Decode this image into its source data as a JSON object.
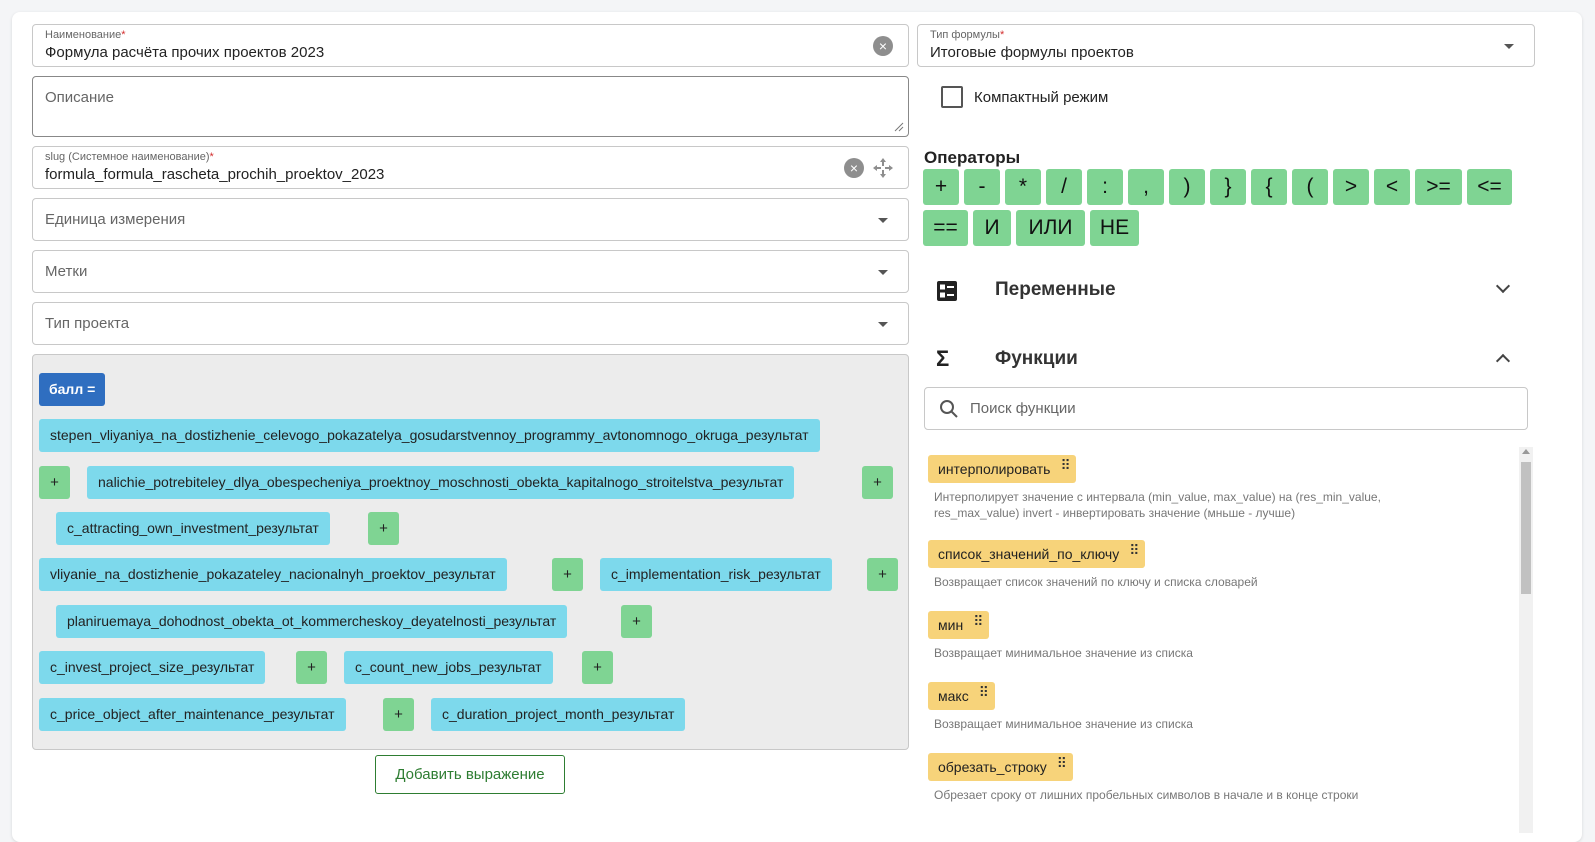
{
  "form": {
    "name_label": "Наименование",
    "name_req": "*",
    "name_value": "Формула расчёта прочих проектов 2023",
    "description_placeholder": "Описание",
    "slug_label": "slug (Системное наименование)",
    "slug_req": "*",
    "slug_value": "formula_formula_rascheta_prochih_proektov_2023",
    "unit_placeholder": "Единица измерения",
    "tags_placeholder": "Метки",
    "project_type_placeholder": "Тип проекта"
  },
  "formula_type": {
    "label": "Тип формулы",
    "req": "*",
    "value": "Итоговые формулы проектов"
  },
  "compact_mode": {
    "label": "Компактный режим",
    "checked": false
  },
  "expression": {
    "score_label": "балл =",
    "chips": [
      "stepen_vliyaniya_na_dostizhenie_celevogo_pokazatelya_gosudarstvennoy_programmy_avtonomnogo_okruga_результат",
      "nalichie_potrebiteley_dlya_obespecheniya_proektnoy_moschnosti_obekta_kapitalnogo_stroitelstva_результат",
      "c_attracting_own_investment_результат",
      "vliyanie_na_dostizhenie_pokazateley_nacionalnyh_proektov_результат",
      "c_implementation_risk_результат",
      "planiruemaya_dohodnost_obekta_ot_kommercheskoy_deyatelnosti_результат",
      "c_invest_project_size_результат",
      "c_count_new_jobs_результат",
      "c_price_object_after_maintenance_результат",
      "c_duration_project_month_результат"
    ],
    "plus": "+",
    "add_button": "Добавить выражение"
  },
  "operators": {
    "title": "Операторы",
    "items": [
      "+",
      "-",
      "*",
      "/",
      ":",
      ",",
      ")",
      "}",
      "{",
      "(",
      ">",
      "<",
      ">=",
      "<=",
      "==",
      "И",
      "ИЛИ",
      "НЕ"
    ]
  },
  "variables_section": {
    "title": "Переменные",
    "icon": "variables-list-icon",
    "expanded": false
  },
  "functions_section": {
    "title": "Функции",
    "icon": "sigma-icon",
    "expanded": true
  },
  "function_search": {
    "placeholder": "Поиск функции"
  },
  "functions": [
    {
      "name": "интерполировать",
      "desc": "Интерполирует значение с интервала (min_value, max_value) на (res_min_value, res_max_value) invert - инвертировать значение (мньше - лучше)"
    },
    {
      "name": "список_значений_по_ключу",
      "desc": "Возвращает список значений по ключу и списка словарей"
    },
    {
      "name": "мин",
      "desc": "Возвращает минимальное значение из списка"
    },
    {
      "name": "макс",
      "desc": "Возвращает минимальное значение из списка"
    },
    {
      "name": "обрезать_строку",
      "desc": "Обрезает сроку от лишних пробельных символов в начале и в конце строки"
    }
  ],
  "colors": {
    "variable_chip": "#7dd9ec",
    "operator_chip": "#7fd493",
    "function_chip": "#f7d37a",
    "score_chip": "#2f6ec0",
    "required": "#d32f2f"
  }
}
